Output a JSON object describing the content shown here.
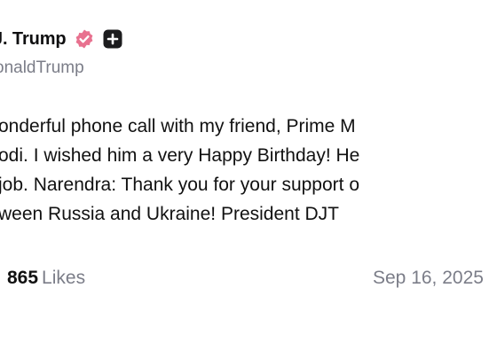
{
  "post": {
    "display_name": "J. Trump",
    "handle": "onaldTrump",
    "body_lines": [
      "onderful phone call with my friend, Prime M",
      "odi. I wished him a very Happy Birthday! He",
      "job. Narendra: Thank you for your support o",
      "ween Russia and Ukraine! President DJT"
    ],
    "likes_count": "865",
    "likes_label": "Likes",
    "timestamp": "Sep 16, 2025"
  },
  "colors": {
    "verified_badge": "#e8718f",
    "plus_badge": "#1c1c1e",
    "muted_text": "#7b7d88"
  },
  "icons": [
    "verified-badge-icon",
    "plus-badge-icon"
  ]
}
